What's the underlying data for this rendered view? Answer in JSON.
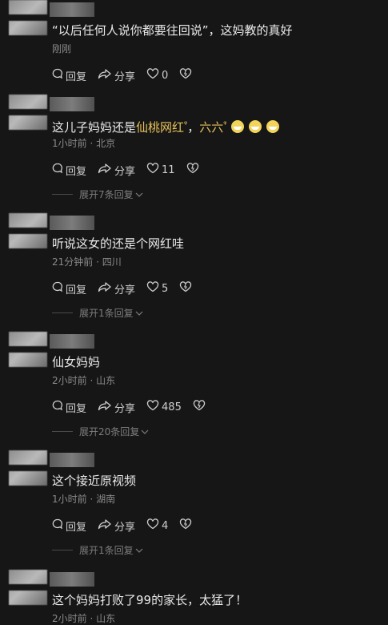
{
  "comments": [
    {
      "text_parts": [
        {
          "t": "“以后任何人说你都要往回说”，这妈教的真好"
        }
      ],
      "meta": "刚刚",
      "reply_label": "回复",
      "share_label": "分享",
      "like_count": "0",
      "expand": ""
    },
    {
      "text_parts": [
        {
          "t": "这儿子妈妈还是"
        },
        {
          "t": "仙桃网红",
          "hl": true,
          "q": true
        },
        {
          "t": "，"
        },
        {
          "t": "六六",
          "hl": true,
          "q": true
        }
      ],
      "emojis": [
        "grin-emoji",
        "grin-emoji",
        "grin-emoji"
      ],
      "meta": "1小时前 · 北京",
      "reply_label": "回复",
      "share_label": "分享",
      "like_count": "11",
      "expand": "展开7条回复"
    },
    {
      "text_parts": [
        {
          "t": "听说这女的还是个网红哇"
        }
      ],
      "meta": "21分钟前 · 四川",
      "reply_label": "回复",
      "share_label": "分享",
      "like_count": "5",
      "expand": "展开1条回复"
    },
    {
      "text_parts": [
        {
          "t": "仙女妈妈"
        }
      ],
      "meta": "2小时前 · 山东",
      "reply_label": "回复",
      "share_label": "分享",
      "like_count": "485",
      "expand": "展开20条回复"
    },
    {
      "text_parts": [
        {
          "t": "这个接近原视频"
        }
      ],
      "meta": "1小时前 · 湖南",
      "reply_label": "回复",
      "share_label": "分享",
      "like_count": "4",
      "expand": "展开1条回复"
    },
    {
      "text_parts": [
        {
          "t": "这个妈妈打败了99的家长，太猛了！"
        }
      ],
      "meta": "2小时前 · 山东",
      "reply_label": "",
      "share_label": "",
      "like_count": "",
      "expand": ""
    }
  ],
  "colors": {
    "background": "#161616",
    "highlight": "#e7c25a",
    "meta": "#8a8a8a"
  },
  "search_glyph": "ᵠ"
}
